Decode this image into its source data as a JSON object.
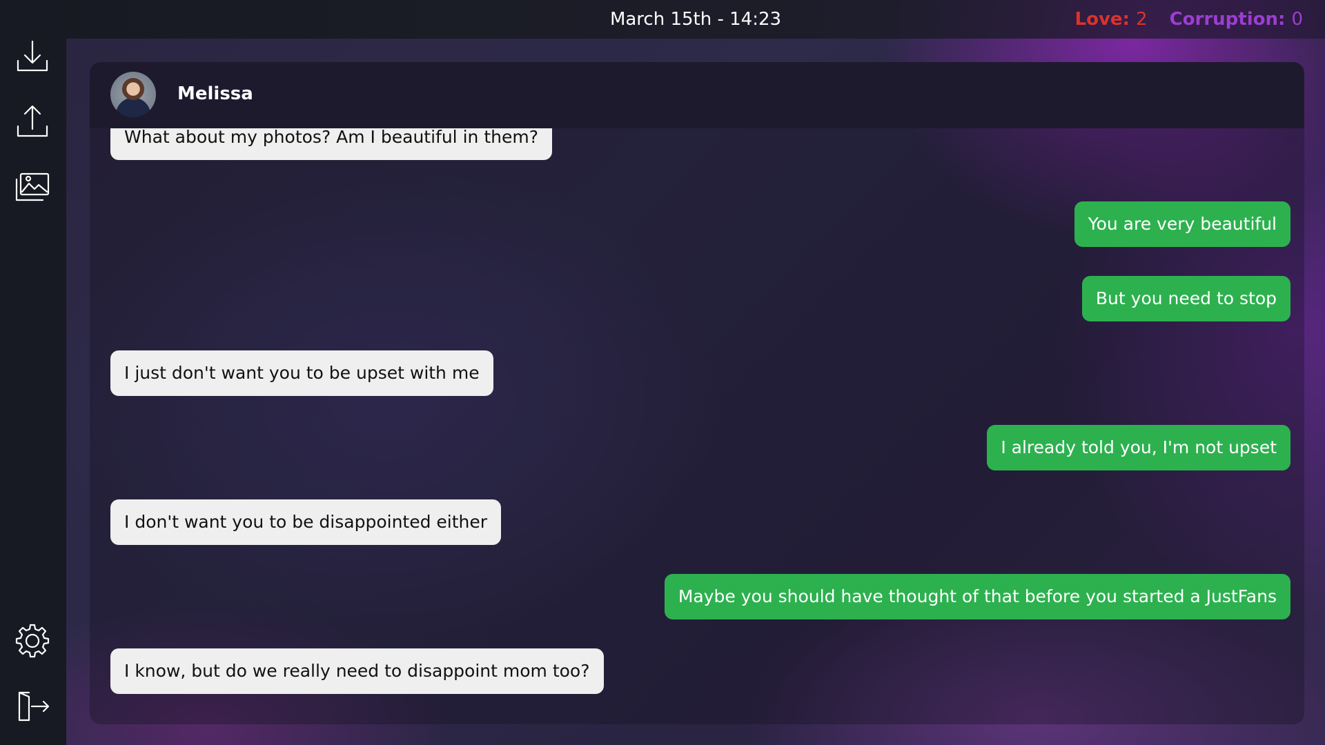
{
  "header": {
    "datetime": "March 15th - 14:23",
    "love_label": "Love:",
    "love_value": "2",
    "corruption_label": "Corruption:",
    "corruption_value": "0"
  },
  "colors": {
    "accent_green": "#2db14f",
    "love": "#d9342b",
    "corruption": "#9b3ed0",
    "incoming_bubble": "#efefef"
  },
  "sidebar": {
    "icons": [
      "download-icon",
      "upload-icon",
      "gallery-icon",
      "settings-icon",
      "exit-icon"
    ]
  },
  "chat": {
    "contact_name": "Melissa",
    "messages": [
      {
        "from": "contact",
        "text": "What about my photos? Am I beautiful in them?"
      },
      {
        "from": "player",
        "text": "You are very beautiful"
      },
      {
        "from": "player",
        "text": "But you need to stop"
      },
      {
        "from": "contact",
        "text": "I just don't want you to be upset with me"
      },
      {
        "from": "player",
        "text": "I already told you, I'm not upset"
      },
      {
        "from": "contact",
        "text": "I don't want you to be disappointed either"
      },
      {
        "from": "player",
        "text": "Maybe you should have thought of that before you started a JustFans"
      },
      {
        "from": "contact",
        "text": "I know, but do we really need to disappoint mom too?"
      }
    ]
  }
}
